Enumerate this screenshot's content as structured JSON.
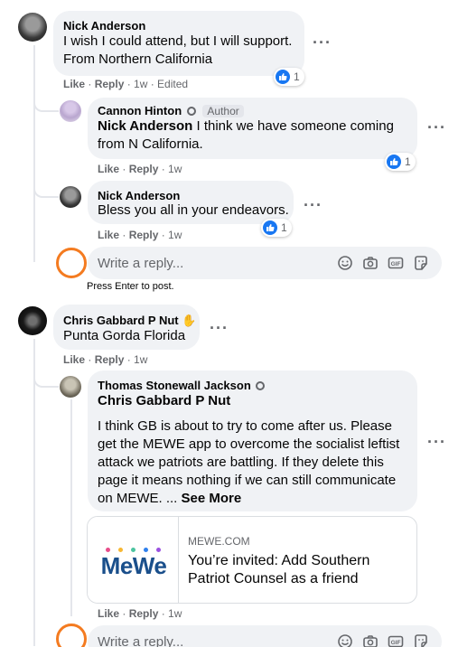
{
  "colors": {
    "accent": "#1877f2",
    "bubble": "#f0f2f5",
    "muted": "#65676b",
    "ring": "#f47b20"
  },
  "comments": {
    "c1": {
      "author": "Nick Anderson",
      "line1": "I wish I could attend, but I will support.",
      "line2": "From Northern California",
      "like": "Like",
      "reply": "Reply",
      "time": "· 1w · Edited",
      "reactions": "1"
    },
    "r1": {
      "author": "Cannon Hinton",
      "badge": "Author",
      "mention": "Nick Anderson",
      "line1_rest": " I think we have someone coming",
      "line2": "from N California.",
      "like": "Like",
      "reply": "Reply",
      "time": "· 1w",
      "reactions": "1"
    },
    "r2": {
      "author": "Nick Anderson",
      "line1": "Bless you all in your endeavors.",
      "like": "Like",
      "reply": "Reply",
      "time": "· 1w",
      "reactions": "1"
    },
    "c2": {
      "author": "Chris Gabbard P Nut",
      "line1": "Punta Gorda Florida",
      "like": "Like",
      "reply": "Reply",
      "time": "· 1w"
    },
    "r3": {
      "author": "Thomas Stonewall Jackson",
      "mention": "Chris Gabbard P Nut",
      "lines": [
        "I think GB is about to try to come after us. Please",
        "get the MEWE app to overcome the socialist leftist",
        "attack we patriots are battling. If they delete this",
        "page it means nothing if we can still communicate",
        "on MEWE. ... "
      ],
      "see_more": "See More",
      "link": {
        "domain": "MEWE.COM",
        "title1": "You’re invited: Add Southern",
        "title2": "Patriot Counsel as a friend",
        "logo": "MeWe"
      },
      "like": "Like",
      "reply": "Reply",
      "time": "· 1w"
    }
  },
  "reply_box": {
    "placeholder": "Write a reply...",
    "hint": "Press Enter to post."
  },
  "icons": [
    "emoji-icon",
    "camera-icon",
    "gif-icon",
    "sticker-icon"
  ]
}
